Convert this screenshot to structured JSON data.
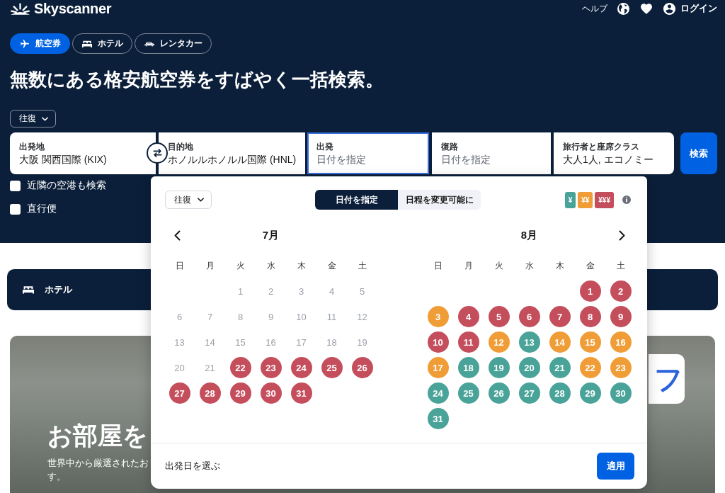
{
  "header": {
    "logo": "Skyscanner",
    "help": "ヘルプ",
    "login": "ログイン"
  },
  "tabs": [
    {
      "kind": "plane",
      "label": "航空券",
      "selected": true
    },
    {
      "kind": "bed",
      "label": "ホテル",
      "selected": false
    },
    {
      "kind": "car",
      "label": "レンタカー",
      "selected": false
    }
  ],
  "headline": "無数にある格安航空券をすばやく一括検索。",
  "trip_type": "往復",
  "search_fields": [
    {
      "label": "出発地",
      "value": "大阪 関西国際 (KIX)",
      "focused": false
    },
    {
      "label": "目的地",
      "value": "ホノルルホノルル国際 (HNL)",
      "focused": false
    },
    {
      "label": "出発",
      "placeholder": "日付を指定",
      "focused": true
    },
    {
      "label": "復路",
      "placeholder": "日付を指定",
      "focused": false
    },
    {
      "label": "旅行者と座席クラス",
      "value": "大人1人, エコノミー",
      "focused": false
    }
  ],
  "search_button": "検索",
  "checkboxes": [
    {
      "label": "近隣の空港も検索",
      "checked": false
    },
    {
      "label": "直行便",
      "checked": false
    }
  ],
  "hotel_banner": {
    "label": "ホテル"
  },
  "hero": {
    "title": "お部屋を",
    "description_lines": [
      "世界中から厳選されたお",
      "す。"
    ],
    "badge": "フ"
  },
  "calendar": {
    "trip_type": "往復",
    "modes": [
      {
        "label": "日付を指定",
        "selected": true
      },
      {
        "label": "日程を変更可能に",
        "selected": false
      }
    ],
    "legend": [
      {
        "label": "¥",
        "color": "#4aa398"
      },
      {
        "label": "¥¥",
        "color": "#f09d37"
      },
      {
        "label": "¥¥¥",
        "color": "#c54e5c"
      }
    ],
    "months": [
      {
        "title": "7月",
        "weekdays": [
          "日",
          "月",
          "火",
          "水",
          "木",
          "金",
          "土"
        ],
        "days": [
          {
            "kind": "blank"
          },
          {
            "kind": "blank"
          },
          {
            "kind": "day",
            "day": "1",
            "disabled": true
          },
          {
            "kind": "day",
            "day": "2",
            "disabled": true
          },
          {
            "kind": "day",
            "day": "3",
            "disabled": true
          },
          {
            "kind": "day",
            "day": "4",
            "disabled": true
          },
          {
            "kind": "day",
            "day": "5",
            "disabled": true
          },
          {
            "kind": "day",
            "day": "6",
            "disabled": true
          },
          {
            "kind": "day",
            "day": "7",
            "disabled": true
          },
          {
            "kind": "day",
            "day": "8",
            "disabled": true
          },
          {
            "kind": "day",
            "day": "9",
            "disabled": true
          },
          {
            "kind": "day",
            "day": "10",
            "disabled": true
          },
          {
            "kind": "day",
            "day": "11",
            "disabled": true
          },
          {
            "kind": "day",
            "day": "12",
            "disabled": true
          },
          {
            "kind": "day",
            "day": "13",
            "disabled": true
          },
          {
            "kind": "day",
            "day": "14",
            "disabled": true
          },
          {
            "kind": "day",
            "day": "15",
            "disabled": true
          },
          {
            "kind": "day",
            "day": "16",
            "disabled": true
          },
          {
            "kind": "day",
            "day": "17",
            "disabled": true
          },
          {
            "kind": "day",
            "day": "18",
            "disabled": true
          },
          {
            "kind": "day",
            "day": "19",
            "disabled": true
          },
          {
            "kind": "day",
            "day": "20",
            "disabled": true
          },
          {
            "kind": "day",
            "day": "21",
            "disabled": true
          },
          {
            "kind": "day",
            "day": "22",
            "disabled": false,
            "color": "#c54e5c"
          },
          {
            "kind": "day",
            "day": "23",
            "disabled": false,
            "color": "#c54e5c"
          },
          {
            "kind": "day",
            "day": "24",
            "disabled": false,
            "color": "#c54e5c"
          },
          {
            "kind": "day",
            "day": "25",
            "disabled": false,
            "color": "#c54e5c"
          },
          {
            "kind": "day",
            "day": "26",
            "disabled": false,
            "color": "#c54e5c"
          },
          {
            "kind": "day",
            "day": "27",
            "disabled": false,
            "color": "#c54e5c"
          },
          {
            "kind": "day",
            "day": "28",
            "disabled": false,
            "color": "#c54e5c"
          },
          {
            "kind": "day",
            "day": "29",
            "disabled": false,
            "color": "#c54e5c"
          },
          {
            "kind": "day",
            "day": "30",
            "disabled": false,
            "color": "#c54e5c"
          },
          {
            "kind": "day",
            "day": "31",
            "disabled": false,
            "color": "#c54e5c"
          }
        ]
      },
      {
        "title": "8月",
        "weekdays": [
          "日",
          "月",
          "火",
          "水",
          "木",
          "金",
          "土"
        ],
        "days": [
          {
            "kind": "blank"
          },
          {
            "kind": "blank"
          },
          {
            "kind": "blank"
          },
          {
            "kind": "blank"
          },
          {
            "kind": "blank"
          },
          {
            "kind": "day",
            "day": "1",
            "disabled": false,
            "color": "#c54e5c"
          },
          {
            "kind": "day",
            "day": "2",
            "disabled": false,
            "color": "#c54e5c"
          },
          {
            "kind": "day",
            "day": "3",
            "disabled": false,
            "color": "#f09d37"
          },
          {
            "kind": "day",
            "day": "4",
            "disabled": false,
            "color": "#c54e5c"
          },
          {
            "kind": "day",
            "day": "5",
            "disabled": false,
            "color": "#c54e5c"
          },
          {
            "kind": "day",
            "day": "6",
            "disabled": false,
            "color": "#c54e5c"
          },
          {
            "kind": "day",
            "day": "7",
            "disabled": false,
            "color": "#c54e5c"
          },
          {
            "kind": "day",
            "day": "8",
            "disabled": false,
            "color": "#c54e5c"
          },
          {
            "kind": "day",
            "day": "9",
            "disabled": false,
            "color": "#c54e5c"
          },
          {
            "kind": "day",
            "day": "10",
            "disabled": false,
            "color": "#c54e5c"
          },
          {
            "kind": "day",
            "day": "11",
            "disabled": false,
            "color": "#c54e5c"
          },
          {
            "kind": "day",
            "day": "12",
            "disabled": false,
            "color": "#f09d37"
          },
          {
            "kind": "day",
            "day": "13",
            "disabled": false,
            "color": "#4aa398"
          },
          {
            "kind": "day",
            "day": "14",
            "disabled": false,
            "color": "#f09d37"
          },
          {
            "kind": "day",
            "day": "15",
            "disabled": false,
            "color": "#f09d37"
          },
          {
            "kind": "day",
            "day": "16",
            "disabled": false,
            "color": "#f09d37"
          },
          {
            "kind": "day",
            "day": "17",
            "disabled": false,
            "color": "#f09d37"
          },
          {
            "kind": "day",
            "day": "18",
            "disabled": false,
            "color": "#4aa398"
          },
          {
            "kind": "day",
            "day": "19",
            "disabled": false,
            "color": "#4aa398"
          },
          {
            "kind": "day",
            "day": "20",
            "disabled": false,
            "color": "#4aa398"
          },
          {
            "kind": "day",
            "day": "21",
            "disabled": false,
            "color": "#4aa398"
          },
          {
            "kind": "day",
            "day": "22",
            "disabled": false,
            "color": "#f09d37"
          },
          {
            "kind": "day",
            "day": "23",
            "disabled": false,
            "color": "#f09d37"
          },
          {
            "kind": "day",
            "day": "24",
            "disabled": false,
            "color": "#4aa398"
          },
          {
            "kind": "day",
            "day": "25",
            "disabled": false,
            "color": "#4aa398"
          },
          {
            "kind": "day",
            "day": "26",
            "disabled": false,
            "color": "#4aa398"
          },
          {
            "kind": "day",
            "day": "27",
            "disabled": false,
            "color": "#4aa398"
          },
          {
            "kind": "day",
            "day": "28",
            "disabled": false,
            "color": "#4aa398"
          },
          {
            "kind": "day",
            "day": "29",
            "disabled": false,
            "color": "#4aa398"
          },
          {
            "kind": "day",
            "day": "30",
            "disabled": false,
            "color": "#4aa398"
          },
          {
            "kind": "day",
            "day": "31",
            "disabled": false,
            "color": "#4aa398"
          }
        ]
      }
    ],
    "footer": "出発日を選ぶ",
    "apply": "適用"
  }
}
